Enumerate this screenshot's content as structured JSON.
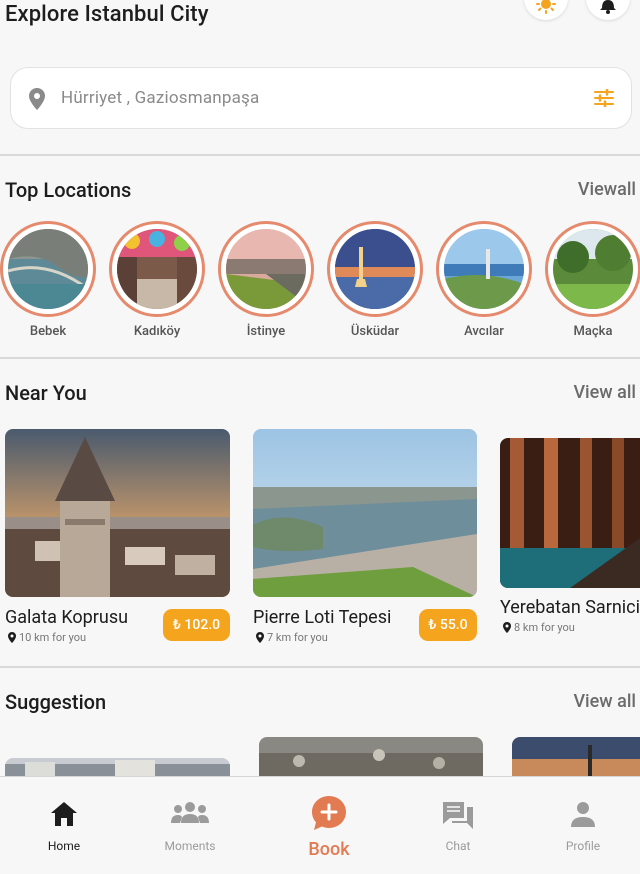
{
  "header": {
    "title": "Explore Istanbul City"
  },
  "search": {
    "placeholder": "Hürriyet , Gaziosmanpaşa"
  },
  "top_locations": {
    "title": "Top Locations",
    "view_all": "Viewall",
    "items": [
      {
        "label": "Bebek"
      },
      {
        "label": "Kadıköy"
      },
      {
        "label": "İstinye"
      },
      {
        "label": "Üsküdar"
      },
      {
        "label": "Avcılar"
      },
      {
        "label": "Maçka"
      }
    ]
  },
  "near_you": {
    "title": "Near You",
    "view_all": "View all",
    "cards": [
      {
        "name": "Galata Koprusu",
        "distance": "10 km for you",
        "price": "₺ 102.0"
      },
      {
        "name": "Pierre Loti Tepesi",
        "distance": "7 km for you",
        "price": "₺ 55.0"
      },
      {
        "name": "Yerebatan Sarnici",
        "distance": "8 km for you"
      }
    ]
  },
  "suggestion": {
    "title": "Suggestion",
    "view_all": "View all"
  },
  "nav": {
    "home": "Home",
    "moments": "Moments",
    "book": "Book",
    "chat": "Chat",
    "profile": "Profile"
  },
  "colors": {
    "accent": "#e27a52",
    "price_badge": "#f5a41e",
    "ring": "#e58a6d"
  }
}
